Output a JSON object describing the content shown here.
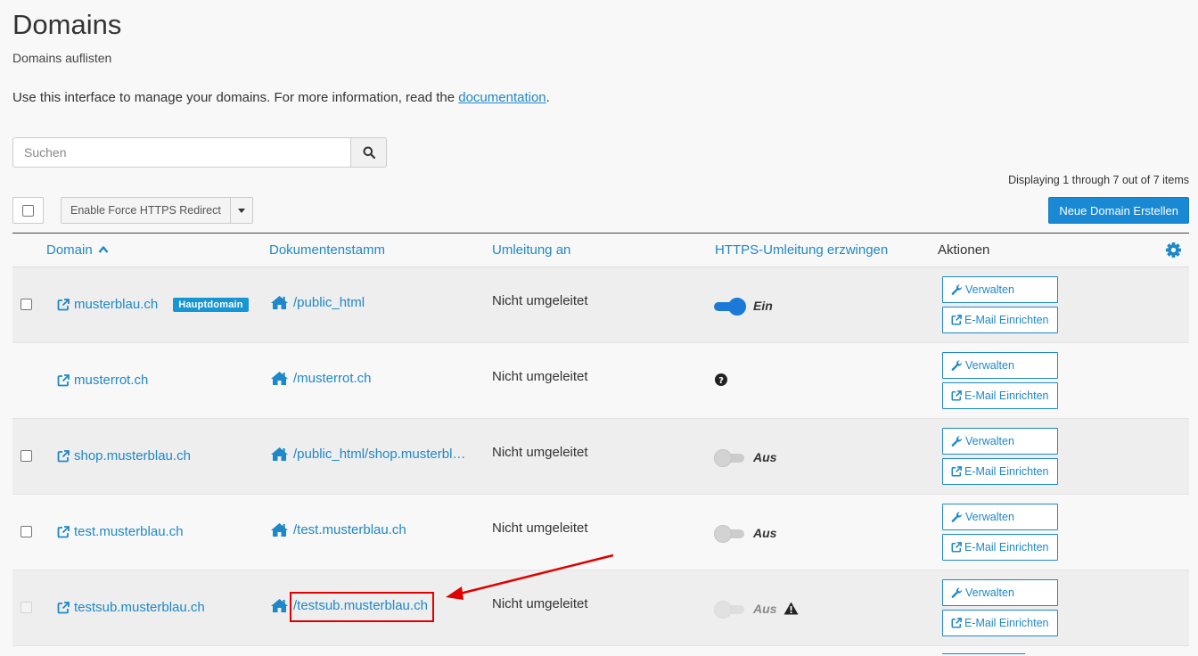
{
  "page": {
    "title": "Domains",
    "subtitle": "Domains auflisten",
    "intro_text": "Use this interface to manage your domains. For more information, read the ",
    "intro_link": "documentation",
    "intro_end": "."
  },
  "search": {
    "placeholder": "Suchen"
  },
  "displaying": "Displaying 1 through 7 out of 7 items",
  "toolbar": {
    "force_https_label": "Enable Force HTTPS Redirect",
    "create_domain_label": "Neue Domain Erstellen"
  },
  "columns": {
    "domain": "Domain",
    "docroot": "Dokumentenstamm",
    "redirect": "Umleitung an",
    "https": "HTTPS-Umleitung erzwingen",
    "actions": "Aktionen"
  },
  "rows": [
    {
      "domain": "musterblau.ch",
      "badge": "Hauptdomain",
      "docroot": "/public_html",
      "redirect": "Nicht umgeleitet",
      "https_state": "Ein",
      "https_mode": "on",
      "checkbox": "enabled"
    },
    {
      "domain": "musterrot.ch",
      "docroot": "/musterrot.ch",
      "redirect": "Nicht umgeleitet",
      "https_mode": "unknown",
      "checkbox": "none"
    },
    {
      "domain": "shop.musterblau.ch",
      "docroot": "/public_html/shop.musterbl…",
      "redirect": "Nicht umgeleitet",
      "https_state": "Aus",
      "https_mode": "off",
      "checkbox": "enabled"
    },
    {
      "domain": "test.musterblau.ch",
      "docroot": "/test.musterblau.ch",
      "redirect": "Nicht umgeleitet",
      "https_state": "Aus",
      "https_mode": "off",
      "checkbox": "enabled"
    },
    {
      "domain": "testsub.musterblau.ch",
      "docroot": "/testsub.musterblau.ch",
      "redirect": "Nicht umgeleitet",
      "https_state": "Aus",
      "https_mode": "disabled",
      "checkbox": "disabled"
    }
  ],
  "actions": {
    "manage_label": "Verwalten",
    "email_label": "E-Mail Einrichten"
  },
  "colors": {
    "link": "#1e88c8",
    "primary": "#1a89d4",
    "badge": "#1696d2",
    "annotation": "#e00000"
  },
  "icons": [
    "search-icon",
    "caret-down-icon",
    "sort-up-icon",
    "gear-icon",
    "external-link-icon",
    "home-icon",
    "question-circle-icon",
    "warning-icon",
    "wrench-icon"
  ]
}
